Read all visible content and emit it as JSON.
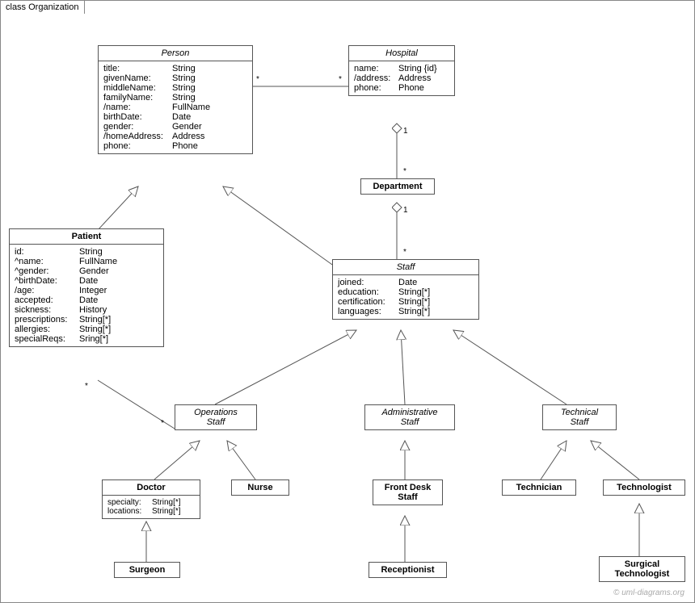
{
  "frame": {
    "label": "class Organization"
  },
  "classes": {
    "person": {
      "name": "Person",
      "attrs": [
        {
          "k": "title:",
          "v": "String"
        },
        {
          "k": "givenName:",
          "v": "String"
        },
        {
          "k": "middleName:",
          "v": "String"
        },
        {
          "k": "familyName:",
          "v": "String"
        },
        {
          "k": "/name:",
          "v": "FullName"
        },
        {
          "k": "birthDate:",
          "v": "Date"
        },
        {
          "k": "gender:",
          "v": "Gender"
        },
        {
          "k": "/homeAddress:",
          "v": "Address"
        },
        {
          "k": "phone:",
          "v": "Phone"
        }
      ]
    },
    "hospital": {
      "name": "Hospital",
      "attrs": [
        {
          "k": "name:",
          "v": "String {id}"
        },
        {
          "k": "/address:",
          "v": "Address"
        },
        {
          "k": "phone:",
          "v": "Phone"
        }
      ]
    },
    "department": {
      "name": "Department"
    },
    "patient": {
      "name": "Patient",
      "attrs": [
        {
          "k": "id:",
          "v": "String"
        },
        {
          "k": "^name:",
          "v": "FullName"
        },
        {
          "k": "^gender:",
          "v": "Gender"
        },
        {
          "k": "^birthDate:",
          "v": "Date"
        },
        {
          "k": "/age:",
          "v": "Integer"
        },
        {
          "k": "accepted:",
          "v": "Date"
        },
        {
          "k": "sickness:",
          "v": "History"
        },
        {
          "k": "prescriptions:",
          "v": "String[*]"
        },
        {
          "k": "allergies:",
          "v": "String[*]"
        },
        {
          "k": "specialReqs:",
          "v": "Sring[*]"
        }
      ]
    },
    "staff": {
      "name": "Staff",
      "attrs": [
        {
          "k": "joined:",
          "v": "Date"
        },
        {
          "k": "education:",
          "v": "String[*]"
        },
        {
          "k": "certification:",
          "v": "String[*]"
        },
        {
          "k": "languages:",
          "v": "String[*]"
        }
      ]
    },
    "opsStaff": {
      "name1": "Operations",
      "name2": "Staff"
    },
    "adminStaff": {
      "name1": "Administrative",
      "name2": "Staff"
    },
    "techStaff": {
      "name1": "Technical",
      "name2": "Staff"
    },
    "doctor": {
      "name": "Doctor",
      "attrs": [
        {
          "k": "specialty:",
          "v": "String[*]"
        },
        {
          "k": "locations:",
          "v": "String[*]"
        }
      ]
    },
    "nurse": {
      "name": "Nurse"
    },
    "frontDesk": {
      "name1": "Front Desk",
      "name2": "Staff"
    },
    "technician": {
      "name": "Technician"
    },
    "technologist": {
      "name": "Technologist"
    },
    "surgeon": {
      "name": "Surgeon"
    },
    "receptionist": {
      "name": "Receptionist"
    },
    "surgTech": {
      "name1": "Surgical",
      "name2": "Technologist"
    }
  },
  "mult": {
    "m1": "*",
    "m2": "*",
    "m3": "1",
    "m4": "*",
    "m5": "1",
    "m6": "*",
    "m7": "*",
    "m8": "*"
  },
  "copyright": "© uml-diagrams.org"
}
